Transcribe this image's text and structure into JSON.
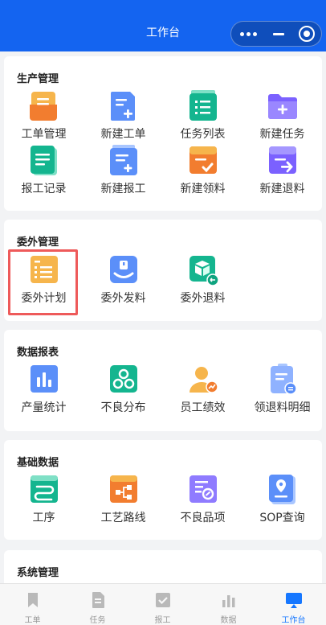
{
  "header": {
    "title": "工作台"
  },
  "sections": [
    {
      "title": "生产管理",
      "items": [
        {
          "label": "工单管理",
          "icon": "work-order-icon"
        },
        {
          "label": "新建工单",
          "icon": "new-work-order-icon"
        },
        {
          "label": "任务列表",
          "icon": "task-list-icon"
        },
        {
          "label": "新建任务",
          "icon": "new-task-folder-icon"
        },
        {
          "label": "报工记录",
          "icon": "report-record-icon"
        },
        {
          "label": "新建报工",
          "icon": "new-report-icon"
        },
        {
          "label": "新建领料",
          "icon": "new-material-pick-icon"
        },
        {
          "label": "新建退料",
          "icon": "new-material-return-icon"
        }
      ]
    },
    {
      "title": "委外管理",
      "items": [
        {
          "label": "委外计划",
          "icon": "outsource-plan-icon"
        },
        {
          "label": "委外发料",
          "icon": "outsource-issue-icon"
        },
        {
          "label": "委外退料",
          "icon": "outsource-return-icon"
        }
      ]
    },
    {
      "title": "数据报表",
      "items": [
        {
          "label": "产量统计",
          "icon": "bar-chart-icon"
        },
        {
          "label": "不良分布",
          "icon": "defect-distribution-icon"
        },
        {
          "label": "员工绩效",
          "icon": "employee-performance-icon"
        },
        {
          "label": "领退料明细",
          "icon": "material-detail-icon"
        }
      ]
    },
    {
      "title": "基础数据",
      "items": [
        {
          "label": "工序",
          "icon": "process-icon"
        },
        {
          "label": "工艺路线",
          "icon": "route-icon"
        },
        {
          "label": "不良品项",
          "icon": "defect-item-icon"
        },
        {
          "label": "SOP查询",
          "icon": "sop-query-icon"
        }
      ]
    },
    {
      "title": "系统管理",
      "items": []
    }
  ],
  "tabbar": [
    {
      "label": "工单",
      "icon": "bookmark-icon",
      "active": false
    },
    {
      "label": "任务",
      "icon": "document-icon",
      "active": false
    },
    {
      "label": "报工",
      "icon": "checkbox-icon",
      "active": false
    },
    {
      "label": "数据",
      "icon": "bar-chart-icon",
      "active": false
    },
    {
      "label": "工作台",
      "icon": "monitor-icon",
      "active": true
    }
  ],
  "colors": {
    "primary": "#1464f0",
    "active_tab": "#1677ff",
    "highlight_border": "#ee5a5a"
  }
}
